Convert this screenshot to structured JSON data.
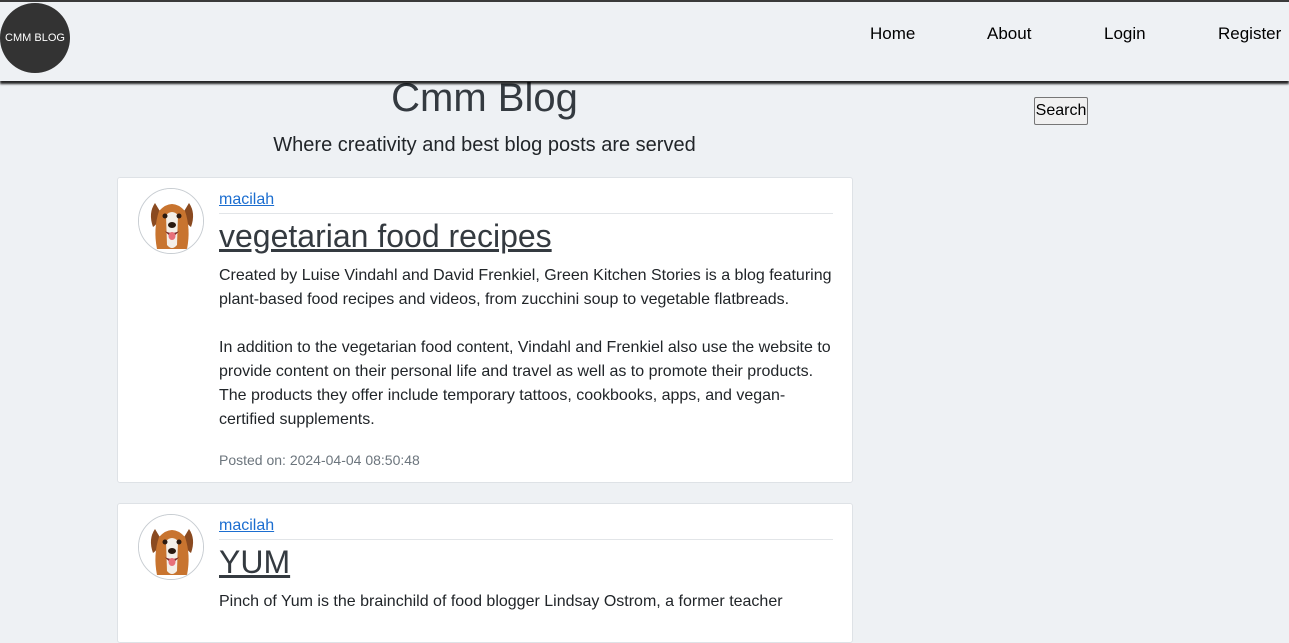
{
  "nav": {
    "logo_text": "CMM BLOG",
    "links": [
      "Home",
      "About",
      "Login",
      "Register"
    ]
  },
  "header": {
    "title": "Cmm Blog",
    "tagline": "Where creativity and best blog posts are served"
  },
  "search": {
    "button_label": "Search"
  },
  "posts": [
    {
      "author": "macilah",
      "title": "vegetarian food recipes",
      "paragraphs": [
        "Created by Luise Vindahl and David Frenkiel, Green Kitchen Stories is a blog featuring plant-based food recipes and videos, from zucchini soup to vegetable flatbreads.",
        "In addition to the vegetarian food content, Vindahl and Frenkiel also use the website to provide content on their personal life and travel as well as to promote their products. The products they offer include temporary tattoos, cookbooks, apps, and vegan-certified supplements."
      ],
      "posted_on": "Posted on: 2024-04-04 08:50:48"
    },
    {
      "author": "macilah",
      "title": "YUM",
      "paragraphs": [
        "Pinch of Yum is the brainchild of food blogger Lindsay Ostrom, a former teacher"
      ]
    }
  ],
  "colors": {
    "page_bg": "#eef1f4",
    "link_blue": "#1c6ed0",
    "logo_bg": "#333333"
  },
  "icons": {
    "avatar": "dog-avatar-icon"
  }
}
